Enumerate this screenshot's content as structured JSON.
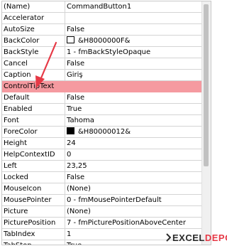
{
  "properties": [
    {
      "name": "(Name)",
      "value": "CommandButton1"
    },
    {
      "name": "Accelerator",
      "value": ""
    },
    {
      "name": "AutoSize",
      "value": "False"
    },
    {
      "name": "BackColor",
      "value": "&H8000000F&",
      "swatch": "#ffffff"
    },
    {
      "name": "BackStyle",
      "value": "1 - fmBackStyleOpaque"
    },
    {
      "name": "Cancel",
      "value": "False"
    },
    {
      "name": "Caption",
      "value": "Giriş"
    },
    {
      "name": "ControlTipText",
      "value": "",
      "highlighted": true
    },
    {
      "name": "Default",
      "value": "False"
    },
    {
      "name": "Enabled",
      "value": "True"
    },
    {
      "name": "Font",
      "value": "Tahoma"
    },
    {
      "name": "ForeColor",
      "value": "&H80000012&",
      "swatch": "#000000"
    },
    {
      "name": "Height",
      "value": "24"
    },
    {
      "name": "HelpContextID",
      "value": "0"
    },
    {
      "name": "Left",
      "value": "23,25"
    },
    {
      "name": "Locked",
      "value": "False"
    },
    {
      "name": "MouseIcon",
      "value": "(None)"
    },
    {
      "name": "MousePointer",
      "value": "0 - fmMousePointerDefault"
    },
    {
      "name": "Picture",
      "value": "(None)"
    },
    {
      "name": "PicturePosition",
      "value": "7 - fmPicturePositionAboveCenter"
    },
    {
      "name": "TabIndex",
      "value": "1"
    },
    {
      "name": "TabStop",
      "value": "True"
    }
  ],
  "highlight_color": "#f59aa0",
  "arrow_color": "#e63946",
  "watermark": {
    "part1": "EXCEL",
    "part2": "DEPO"
  }
}
